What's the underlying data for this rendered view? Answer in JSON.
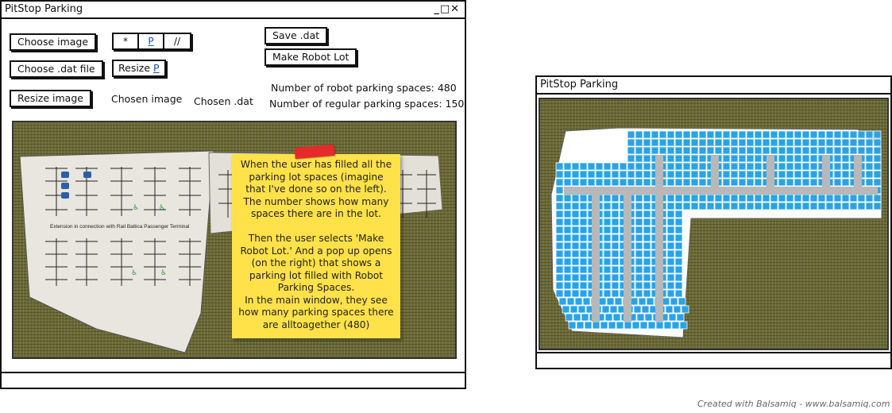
{
  "main_window": {
    "title": "PitStop Parking",
    "controls": "_□✕"
  },
  "toolbar": {
    "choose_image": "Choose image",
    "choose_dat": "Choose .dat file",
    "resize_image": "Resize image",
    "segments": [
      "*",
      "P",
      "//"
    ],
    "resize_prefix": "Resize ",
    "resize_p": "P",
    "save_dat": "Save .dat",
    "make_robot_lot": "Make Robot Lot"
  },
  "labels": {
    "chosen_image": "Chosen image",
    "chosen_dat": "Chosen .dat"
  },
  "stats": {
    "robot_spaces": "Number of robot parking spaces: 480",
    "regular_spaces": "Number of regular parking spaces: 150"
  },
  "map": {
    "caption": "Extension in connection with Rail Baltica Passenger Terminal"
  },
  "sticky_note": {
    "text": "When the user has filled all the parking lot spaces (imagine that I've done so on the left). The number shows how many spaces there are in the lot.\n\nThen the user selects 'Make Robot Lot.' And a pop up opens (on the right) that shows a parking lot filled with Robot Parking Spaces.\nIn the main window, they see how many parking spaces there are alltoagether (480)"
  },
  "popup_window": {
    "title": "PitStop Parking"
  },
  "credit": "Created with Balsamiq - www.balsamiq.com",
  "colors": {
    "grass": "#6b6a36",
    "sticky": "#ffe149",
    "tape": "#e62a2a",
    "robot_space": "#2aa3e6",
    "link": "#1a4fb8"
  }
}
